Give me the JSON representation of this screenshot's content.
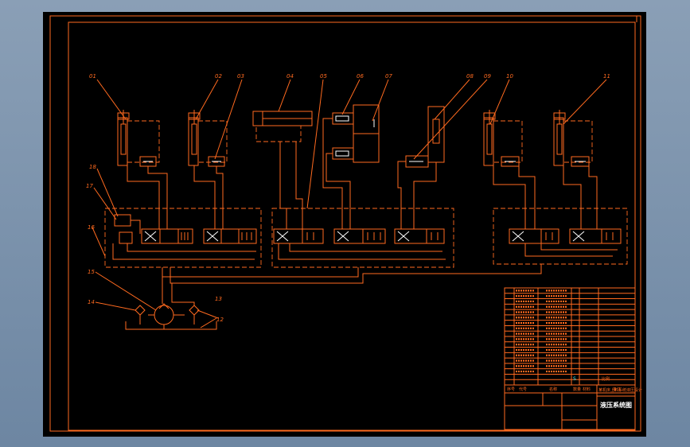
{
  "callouts": [
    "01",
    "02",
    "03",
    "04",
    "05",
    "06",
    "07",
    "08",
    "09",
    "10",
    "11",
    "12",
    "13",
    "14",
    "15",
    "16",
    "17",
    "18"
  ],
  "title_block": {
    "drawing_title": "液压系统图",
    "project_title": "某机床上料系统液压设计",
    "header_no": "序号",
    "header_code": "代号",
    "header_name": "名称",
    "header_qty": "数量",
    "header_material": "材料",
    "header_remark": "备注",
    "mark_a": "S",
    "mark_b": "比例"
  }
}
